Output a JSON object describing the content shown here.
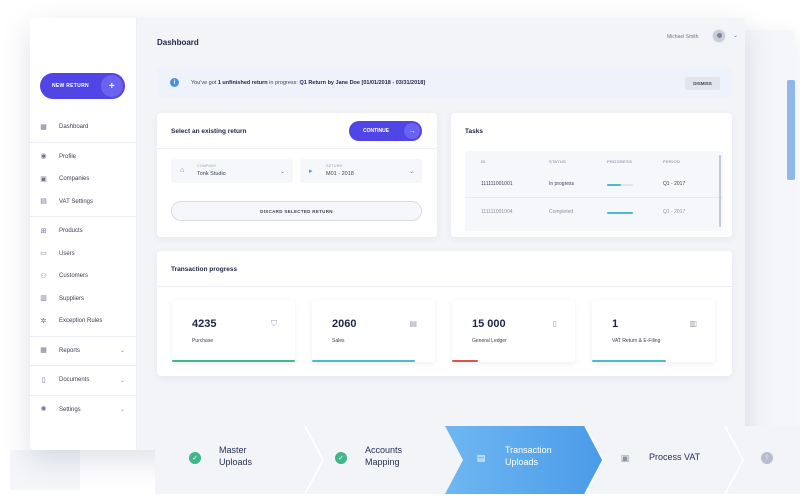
{
  "header": {
    "title": "Dashboard",
    "user_name": "Michael Smith"
  },
  "sidebar": {
    "new_return_label": "NEW RETURN",
    "items": [
      {
        "label": "Dashboard",
        "icon": "grid-icon"
      },
      {
        "label": "Profile",
        "icon": "user-icon"
      },
      {
        "label": "Companies",
        "icon": "building-icon"
      },
      {
        "label": "VAT Settings",
        "icon": "document-icon"
      },
      {
        "label": "Products",
        "icon": "cart-icon"
      },
      {
        "label": "Users",
        "icon": "users-icon"
      },
      {
        "label": "Customers",
        "icon": "customers-icon"
      },
      {
        "label": "Suppliers",
        "icon": "suppliers-icon"
      },
      {
        "label": "Exception Rules",
        "icon": "gear-icon"
      },
      {
        "label": "Reports",
        "icon": "report-icon"
      },
      {
        "label": "Documents",
        "icon": "file-icon"
      },
      {
        "label": "Settings",
        "icon": "settings-icon"
      }
    ]
  },
  "notice": {
    "prefix": "You've got ",
    "count": "1 unfinished return",
    "middle": " in progress: ",
    "return_name": "Q1 Return by Jane Doe [01/01/2018 - 03/31/2018]",
    "dismiss_label": "DISMISS"
  },
  "select_return": {
    "title": "Select an existing return",
    "continue_label": "CONTINUE",
    "company_label": "COMPANY",
    "company_value": "Tonk Studio",
    "return_label": "RETURN",
    "return_value": "M01 - 2018",
    "discard_label": "DISCARD SELECTED RETURN"
  },
  "tasks": {
    "title": "Tasks",
    "columns": [
      "ID",
      "STATUS",
      "PROGRESS",
      "PERIOD"
    ],
    "rows": [
      {
        "id": "111111001001",
        "status": "In progress",
        "progress": 0.55,
        "period": "Q1 - 2017"
      },
      {
        "id": "111111001004",
        "status": "Completed",
        "progress": 1.0,
        "period": "Q1 - 2017"
      }
    ]
  },
  "transactions": {
    "title": "Transaction progress",
    "stats": [
      {
        "value": "4235",
        "label": "Purchase",
        "icon": "basket-icon",
        "color": "#3fb68b"
      },
      {
        "value": "2060",
        "label": "Sales",
        "icon": "store-icon",
        "color": "#4fb8c9"
      },
      {
        "value": "15 000",
        "label": "General Ledger",
        "icon": "ledger-icon",
        "color": "#d9534f"
      },
      {
        "value": "1",
        "label": "VAT Return & E-Filing",
        "icon": "clipboard-icon",
        "color": "#4fb8c9"
      }
    ]
  },
  "stepper": {
    "steps": [
      {
        "line1": "Master",
        "line2": "Uploads",
        "state": "done"
      },
      {
        "line1": "Accounts",
        "line2": "Mapping",
        "state": "done"
      },
      {
        "line1": "Transaction",
        "line2": "Uploads",
        "state": "active"
      },
      {
        "line1": "Process VAT",
        "line2": "",
        "state": "pending"
      }
    ]
  },
  "colors": {
    "primary": "#4f46e5",
    "accent": "#4a90e2",
    "success": "#3fb68b"
  }
}
